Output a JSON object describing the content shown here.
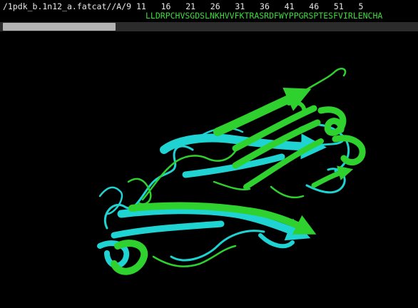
{
  "sequence_viewer": {
    "object_label": "/1pdk_b.1n12_a.fatcat//A/9",
    "ruler_numbers": "11   16   21   26   31   36   41   46   51   5",
    "residues": "LLDRPCHVSGDSLNKHVVFKTRASRDFWYPPGRSPTESFVIRLENCHA"
  },
  "colors": {
    "chain_a": "#2ed12e",
    "chain_b": "#1fd3d3",
    "background": "#000000",
    "sequence_text": "#3fd93f",
    "label_text": "#e8e8e8"
  }
}
